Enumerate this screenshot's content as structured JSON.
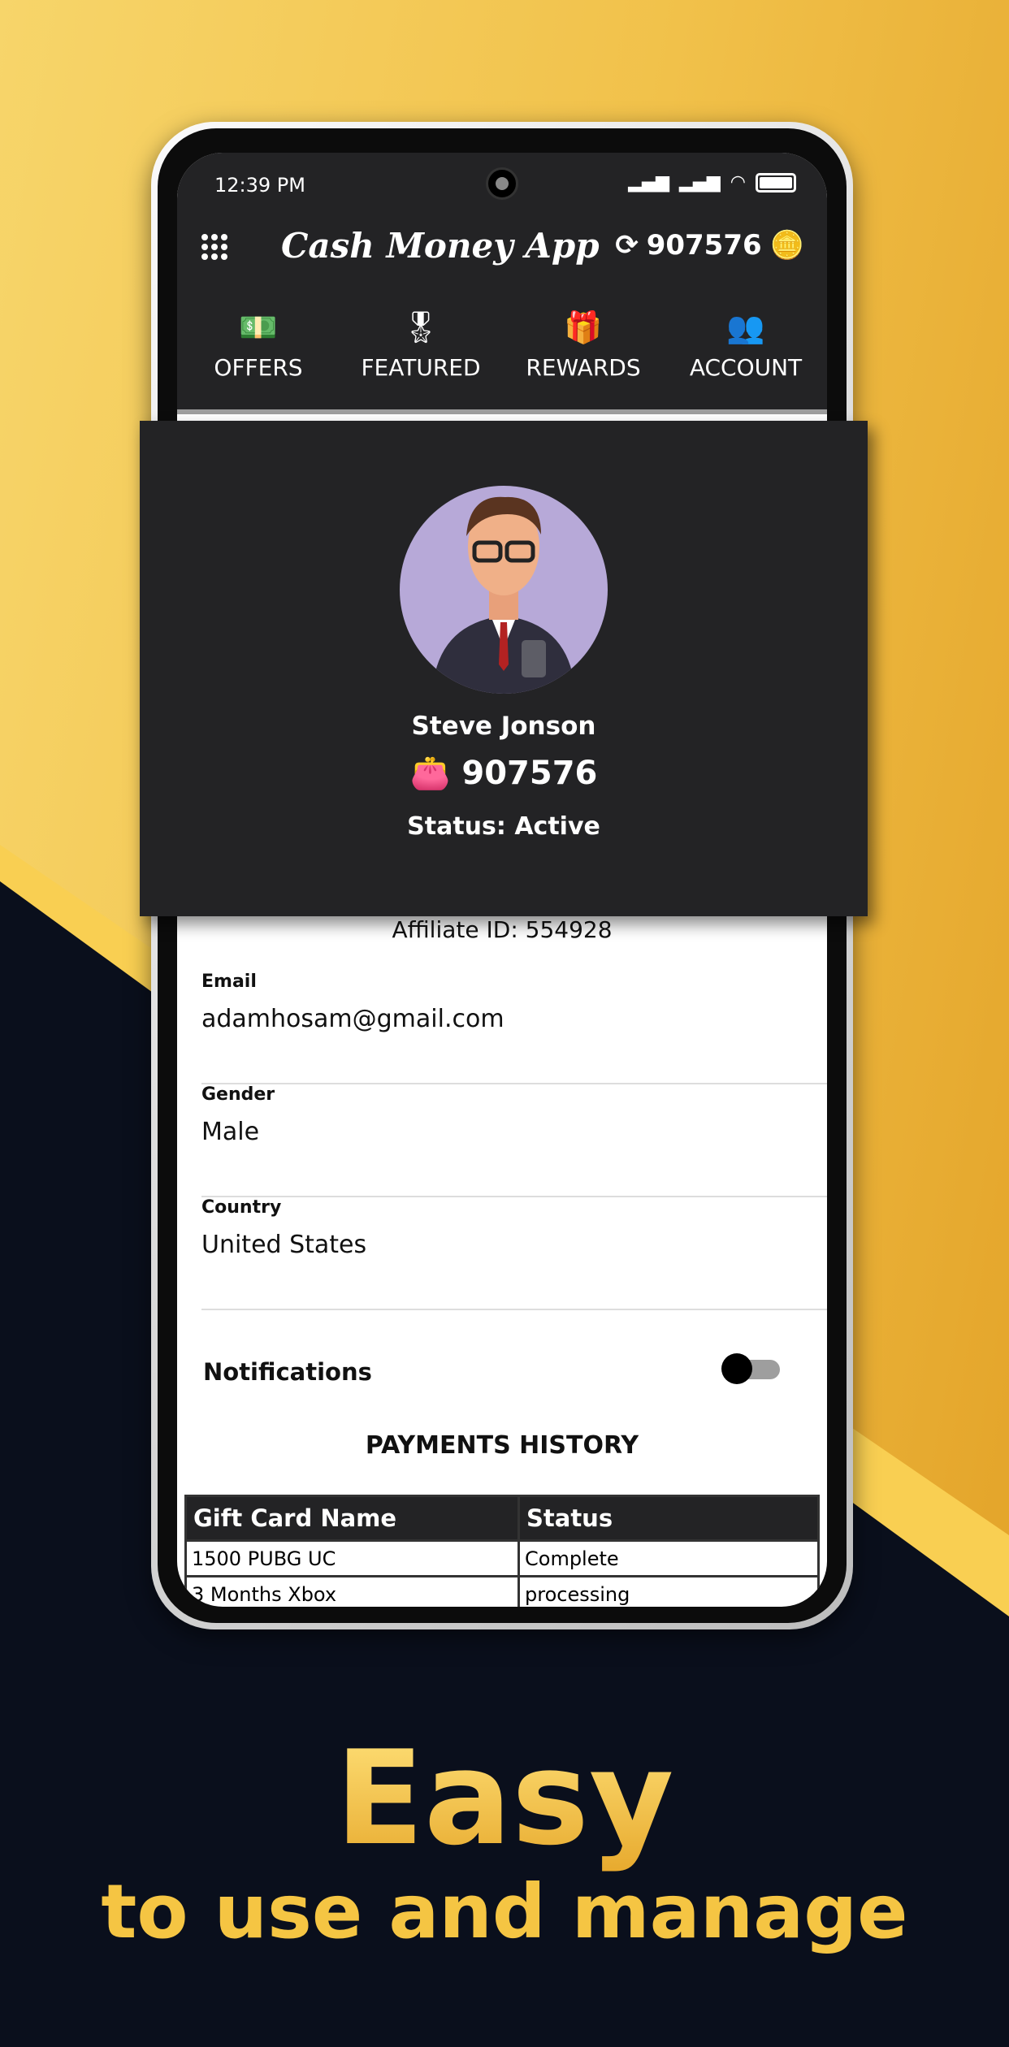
{
  "status_bar": {
    "time": "12:39 PM"
  },
  "header": {
    "title": "Cash Money App",
    "balance": "907576",
    "menu_icon": "grid-menu-icon",
    "refresh_icon": "refresh-icon",
    "coins_icon": "coins-icon"
  },
  "tabs": [
    {
      "label": "OFFERS",
      "icon": "cash-icon"
    },
    {
      "label": "FEATURED",
      "icon": "award-icon"
    },
    {
      "label": "REWARDS",
      "icon": "gift-icon"
    },
    {
      "label": "ACCOUNT",
      "icon": "users-icon",
      "active": true
    }
  ],
  "profile": {
    "name": "Steve Jonson",
    "balance": "907576",
    "status": "Status: Active"
  },
  "account": {
    "affiliate": "Affiliate ID: 554928",
    "fields": [
      {
        "label": "Email",
        "value": "adamhosam@gmail.com"
      },
      {
        "label": "Gender",
        "value": "Male"
      },
      {
        "label": "Country",
        "value": "United States"
      }
    ],
    "notifications_label": "Notifications",
    "notifications_on": false
  },
  "payments": {
    "title": "PAYMENTS HISTORY",
    "headers": [
      "Gift Card Name",
      "Status"
    ],
    "rows": [
      [
        "1500 PUBG UC",
        "Complete"
      ],
      [
        "3 Months Xbox",
        "processing"
      ]
    ]
  },
  "promo": {
    "headline": "Easy",
    "tagline": "to use and manage"
  },
  "colors": {
    "accent": "#f5c543",
    "dark": "#232325",
    "background_dark": "#0a0f1c"
  }
}
